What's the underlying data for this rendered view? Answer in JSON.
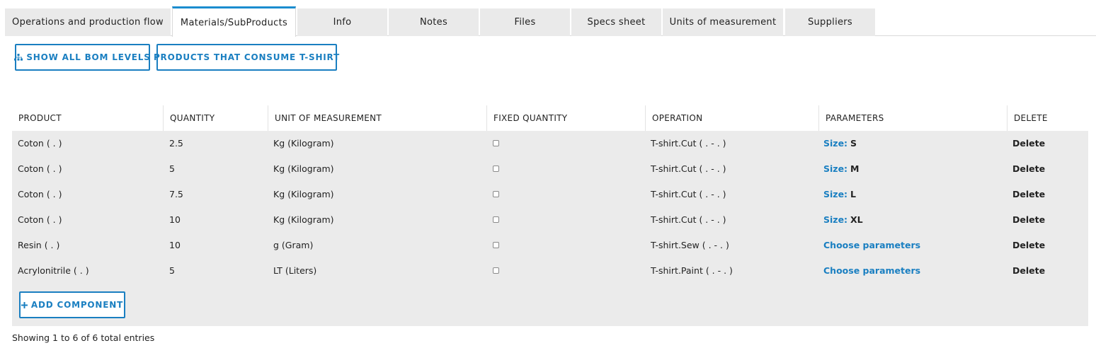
{
  "tabs": [
    {
      "label": "Operations and production flow",
      "active": false
    },
    {
      "label": "Materials/SubProducts",
      "active": true
    },
    {
      "label": "Info",
      "active": false
    },
    {
      "label": "Notes",
      "active": false
    },
    {
      "label": "Files",
      "active": false
    },
    {
      "label": "Specs sheet",
      "active": false
    },
    {
      "label": "Units of measurement",
      "active": false
    },
    {
      "label": "Suppliers",
      "active": false
    }
  ],
  "toolbar": {
    "show_bom_label": "SHOW ALL BOM LEVELS",
    "consumers_label": "PRODUCTS THAT CONSUME T-SHIRT"
  },
  "table": {
    "headers": [
      "PRODUCT",
      "QUANTITY",
      "UNIT OF MEASUREMENT",
      "FIXED QUANTITY",
      "OPERATION",
      "PARAMETERS",
      "DELETE"
    ],
    "rows": [
      {
        "product": "Coton ( . )",
        "quantity": "2.5",
        "unit": "Kg (Kilogram)",
        "fixed": false,
        "operation": "T-shirt.Cut ( . - . )",
        "param_label": "Size:",
        "param_value": "S",
        "delete": "Delete"
      },
      {
        "product": "Coton ( . )",
        "quantity": "5",
        "unit": "Kg (Kilogram)",
        "fixed": false,
        "operation": "T-shirt.Cut ( . - . )",
        "param_label": "Size:",
        "param_value": "M",
        "delete": "Delete"
      },
      {
        "product": "Coton ( . )",
        "quantity": "7.5",
        "unit": "Kg (Kilogram)",
        "fixed": false,
        "operation": "T-shirt.Cut ( . - . )",
        "param_label": "Size:",
        "param_value": "L",
        "delete": "Delete"
      },
      {
        "product": "Coton ( . )",
        "quantity": "10",
        "unit": "Kg (Kilogram)",
        "fixed": false,
        "operation": "T-shirt.Cut ( . - . )",
        "param_label": "Size:",
        "param_value": "XL",
        "delete": "Delete"
      },
      {
        "product": "Resin ( . )",
        "quantity": "10",
        "unit": "g (Gram)",
        "fixed": false,
        "operation": "T-shirt.Sew ( . - . )",
        "param_label": "Choose parameters",
        "param_value": "",
        "delete": "Delete"
      },
      {
        "product": "Acrylonitrile ( . )",
        "quantity": "5",
        "unit": "LT (Liters)",
        "fixed": false,
        "operation": "T-shirt.Paint ( . - . )",
        "param_label": "Choose parameters",
        "param_value": "",
        "delete": "Delete"
      }
    ],
    "add_label": "ADD COMPONENT"
  },
  "footer": {
    "entries_text": "Showing 1 to 6 of 6 total entries"
  },
  "colors": {
    "accent": "#1a7fc1",
    "tab_bg": "#eaeaea",
    "row_bg": "#ebebeb"
  },
  "icons": {
    "show_bom": "sitemap-icon",
    "add": "plus-icon",
    "checkbox": "checkbox-icon"
  }
}
